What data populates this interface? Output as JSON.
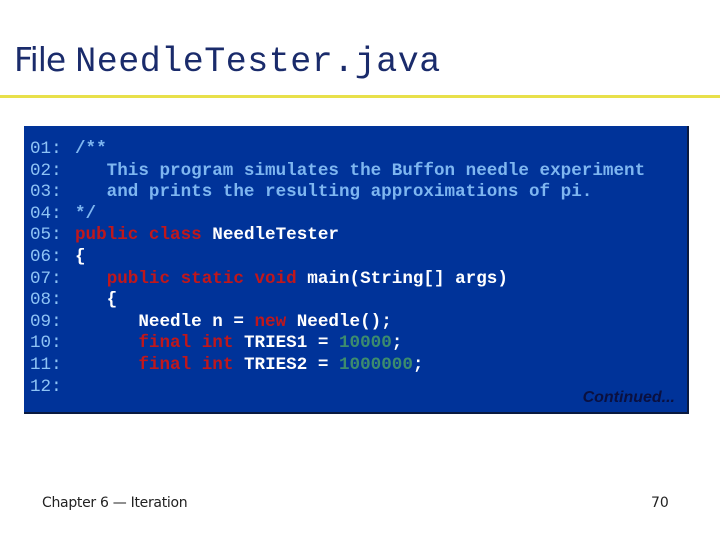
{
  "header": {
    "label": "File",
    "filename": "NeedleTester.java"
  },
  "colors": {
    "background_box": "#003399",
    "comment": "#7eb6f0",
    "keyword": "#c0171b",
    "plain": "#ffffff",
    "number": "#3c8c6e",
    "line_number": "#8ec3f5",
    "rule": "#e8e04a",
    "title": "#1a2b6b"
  },
  "code": {
    "lines": [
      {
        "num": "01:",
        "tokens": [
          {
            "t": "comment",
            "v": "/**"
          }
        ]
      },
      {
        "num": "02:",
        "tokens": [
          {
            "t": "comment",
            "v": "   This program simulates the Buffon needle experiment"
          }
        ]
      },
      {
        "num": "03:",
        "tokens": [
          {
            "t": "comment",
            "v": "   and prints the resulting approximations of pi."
          }
        ]
      },
      {
        "num": "04:",
        "tokens": [
          {
            "t": "comment",
            "v": "*/"
          }
        ]
      },
      {
        "num": "05:",
        "tokens": [
          {
            "t": "keyword",
            "v": "public class "
          },
          {
            "t": "plain",
            "v": "NeedleTester"
          }
        ]
      },
      {
        "num": "06:",
        "tokens": [
          {
            "t": "plain",
            "v": "{"
          }
        ]
      },
      {
        "num": "07:",
        "tokens": [
          {
            "t": "plain",
            "v": "   "
          },
          {
            "t": "keyword",
            "v": "public static void "
          },
          {
            "t": "plain",
            "v": "main(String[] args)"
          }
        ]
      },
      {
        "num": "08:",
        "tokens": [
          {
            "t": "plain",
            "v": "   {"
          }
        ]
      },
      {
        "num": "09:",
        "tokens": [
          {
            "t": "plain",
            "v": "      Needle n = "
          },
          {
            "t": "keyword",
            "v": "new "
          },
          {
            "t": "plain",
            "v": "Needle();"
          }
        ]
      },
      {
        "num": "10:",
        "tokens": [
          {
            "t": "plain",
            "v": "      "
          },
          {
            "t": "keyword",
            "v": "final int "
          },
          {
            "t": "plain",
            "v": "TRIES1 = "
          },
          {
            "t": "number",
            "v": "10000"
          },
          {
            "t": "plain",
            "v": ";"
          }
        ]
      },
      {
        "num": "11:",
        "tokens": [
          {
            "t": "plain",
            "v": "      "
          },
          {
            "t": "keyword",
            "v": "final int "
          },
          {
            "t": "plain",
            "v": "TRIES2 = "
          },
          {
            "t": "number",
            "v": "1000000"
          },
          {
            "t": "plain",
            "v": ";"
          }
        ]
      },
      {
        "num": "12:",
        "tokens": []
      }
    ],
    "continued_label": "Continued..."
  },
  "footer": {
    "chapter": "Chapter 6 — Iteration",
    "page": "70"
  }
}
